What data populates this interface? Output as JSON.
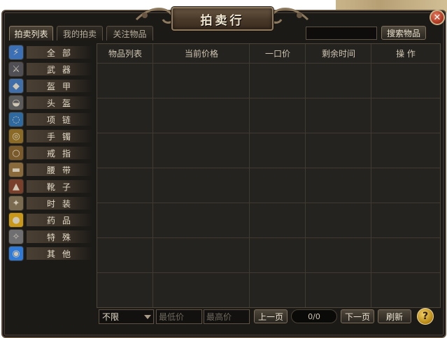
{
  "window": {
    "title": "拍卖行",
    "close_symbol": "✕"
  },
  "tabs": [
    {
      "label": "拍卖列表",
      "active": true
    },
    {
      "label": "我的拍卖",
      "active": false
    },
    {
      "label": "关注物品",
      "active": false
    }
  ],
  "search": {
    "value": "",
    "button_label": "搜索物品"
  },
  "categories": [
    {
      "label": "全部",
      "icon": "all-icon",
      "glyph": "⚡",
      "color": "#3b6fb6"
    },
    {
      "label": "武器",
      "icon": "sword-icon",
      "glyph": "⚔",
      "color": "#4f4f55"
    },
    {
      "label": "盔甲",
      "icon": "armor-icon",
      "glyph": "◆",
      "color": "#3f6ea8"
    },
    {
      "label": "头盔",
      "icon": "helmet-icon",
      "glyph": "◒",
      "color": "#5b5b5b"
    },
    {
      "label": "项链",
      "icon": "necklace-icon",
      "glyph": "◌",
      "color": "#2e6aa0"
    },
    {
      "label": "手镯",
      "icon": "bracelet-icon",
      "glyph": "◎",
      "color": "#8a6a25"
    },
    {
      "label": "戒指",
      "icon": "ring-icon",
      "glyph": "○",
      "color": "#7a5a2a"
    },
    {
      "label": "腰带",
      "icon": "belt-icon",
      "glyph": "▬",
      "color": "#8a6a3a"
    },
    {
      "label": "靴子",
      "icon": "boots-icon",
      "glyph": "▲",
      "color": "#7a3f2a"
    },
    {
      "label": "时装",
      "icon": "fashion-icon",
      "glyph": "✦",
      "color": "#7a6a50"
    },
    {
      "label": "药品",
      "icon": "potion-icon",
      "glyph": "●",
      "color": "#c99818"
    },
    {
      "label": "特殊",
      "icon": "special-icon",
      "glyph": "✧",
      "color": "#6f6f72"
    },
    {
      "label": "其他",
      "icon": "other-icon",
      "glyph": "◉",
      "color": "#2f7ad6"
    }
  ],
  "table": {
    "columns": [
      "物品列表",
      "当前价格",
      "一口价",
      "剩余时间",
      "操 作"
    ],
    "rows": []
  },
  "footer": {
    "filter_value": "不限",
    "min_price_placeholder": "最低价",
    "max_price_placeholder": "最高价",
    "prev_label": "上一页",
    "page_indicator": "0/0",
    "next_label": "下一页",
    "refresh_label": "刷新",
    "help_symbol": "?"
  }
}
